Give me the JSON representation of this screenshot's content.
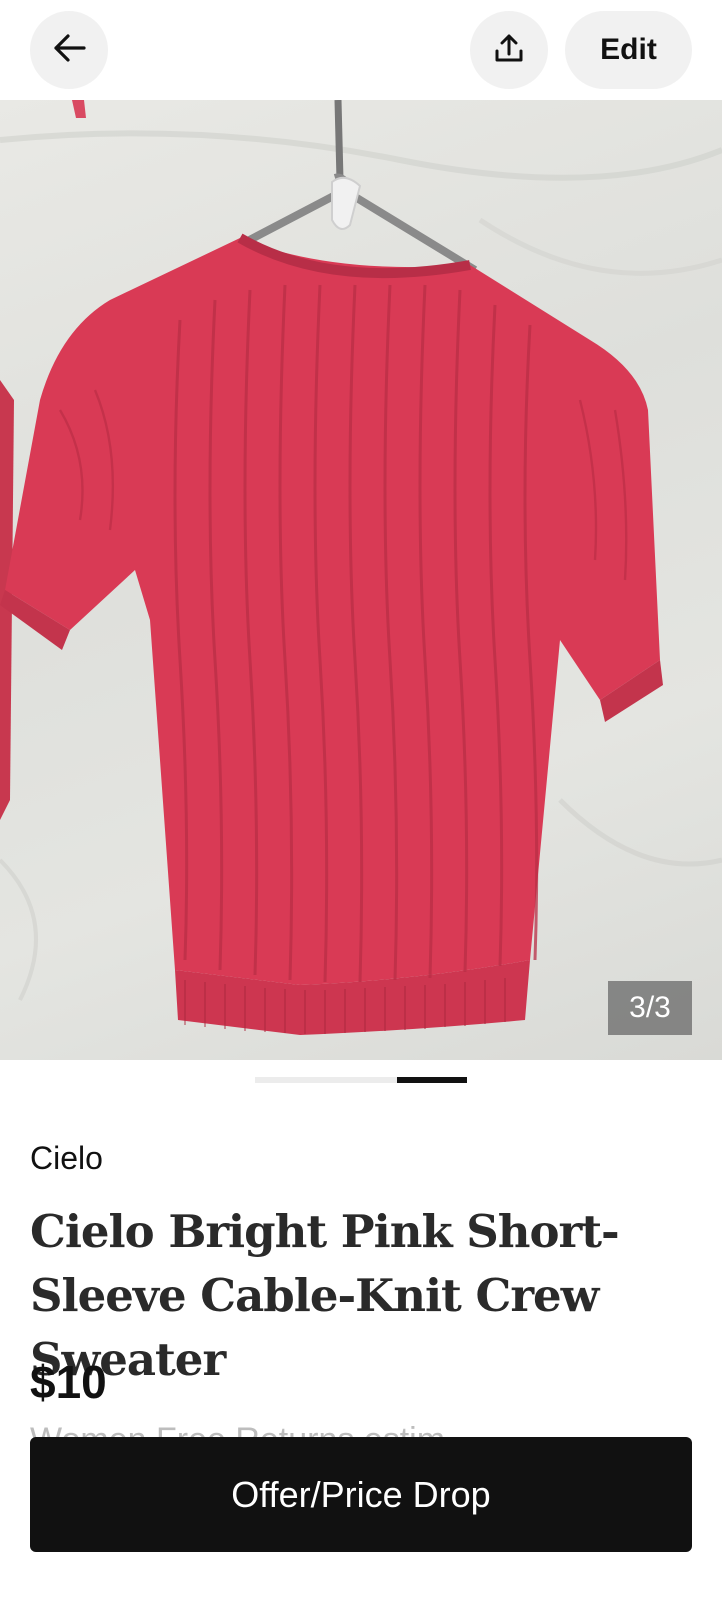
{
  "header": {
    "back_icon": "arrow-left-icon",
    "share_icon": "share-upload-icon",
    "edit_label": "Edit"
  },
  "gallery": {
    "counter": "3/3",
    "current_index": 3,
    "total": 3,
    "image_description_color": "#d93a55"
  },
  "listing": {
    "brand": "Cielo",
    "title": "Cielo Bright Pink Short-Sleeve Cable-Knit Crew Sweater",
    "price": "$10",
    "partial_text": "Women Free Returns estim"
  },
  "cta": {
    "label": "Offer/Price Drop"
  },
  "colors": {
    "button_bg": "#111111",
    "pill_bg": "#f1f1f1",
    "sweater": "#d93a55"
  }
}
